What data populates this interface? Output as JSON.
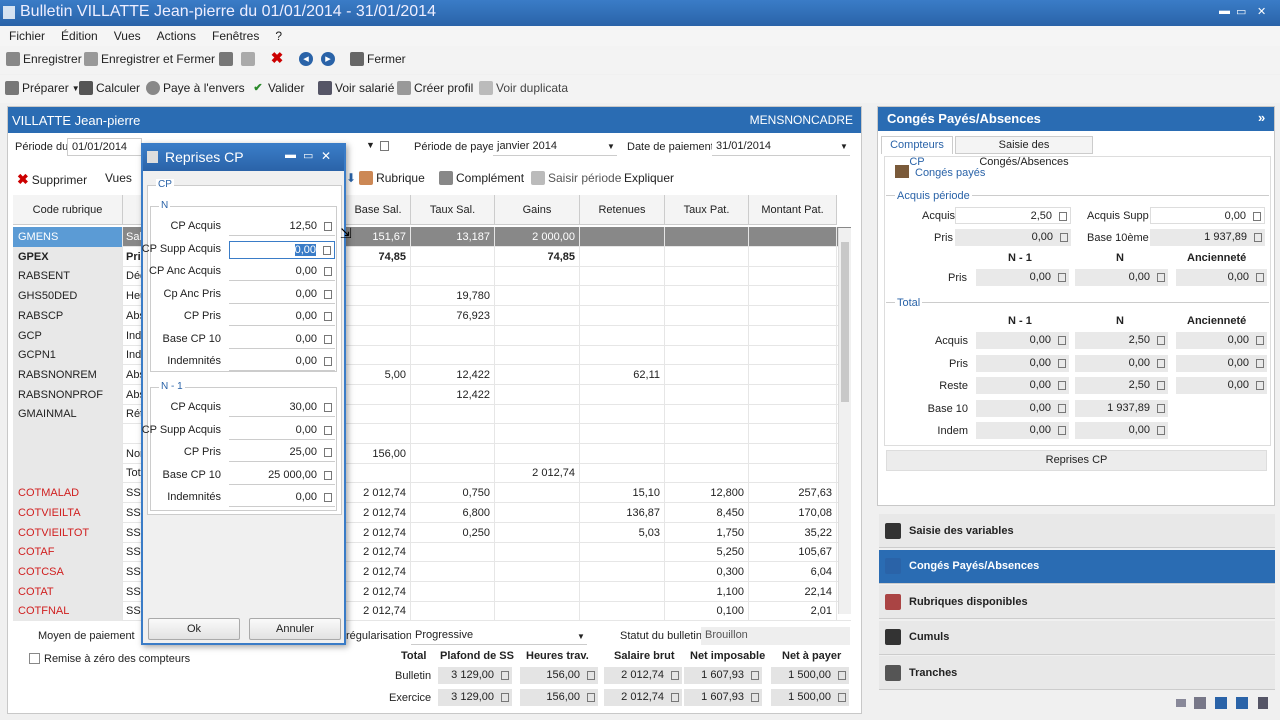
{
  "window": {
    "title": "Bulletin VILLATTE Jean-pierre du 01/01/2014 - 31/01/2014",
    "controls": [
      "▬",
      "▭",
      "✕"
    ]
  },
  "menu": [
    "Fichier",
    "Édition",
    "Vues",
    "Actions",
    "Fenêtres",
    "?"
  ],
  "toolbar1": {
    "save": "Enregistrer",
    "save_close": "Enregistrer et Fermer",
    "close": "Fermer"
  },
  "toolbar2": {
    "prepare": "Préparer",
    "compute": "Calculer",
    "reverse": "Paye à l'envers",
    "validate": "Valider",
    "view_employee": "Voir salarié",
    "create_profile": "Créer profil",
    "view_duplicate": "Voir duplicata"
  },
  "employee": {
    "name": "VILLATTE Jean-pierre",
    "category": "MENSNONCADRE"
  },
  "period": {
    "from_label": "Période du",
    "from": "01/01/2014",
    "pay_period_label": "Période de paye",
    "pay_period": "janvier 2014",
    "pay_date_label": "Date de paiement",
    "pay_date": "31/01/2014"
  },
  "actions": {
    "delete": "Supprimer",
    "views": "Vues",
    "rubric": "Rubrique",
    "complement": "Complément",
    "enter_period": "Saisir période",
    "explain": "Expliquer"
  },
  "grid": {
    "headers": [
      "Code rubrique",
      "Base Sal.",
      "Taux Sal.",
      "Gains",
      "Retenues",
      "Taux Pat.",
      "Montant Pat."
    ],
    "rows": [
      {
        "code": "GMENS",
        "lib": "Sal",
        "base": "151,67",
        "taux": "13,187",
        "gains": "2 000,00",
        "ret": "",
        "tpat": "",
        "mpat": "",
        "style": "sel"
      },
      {
        "code": "GPEX",
        "lib": "Pri",
        "base": "74,85",
        "taux": "",
        "gains": "74,85",
        "ret": "",
        "tpat": "",
        "mpat": "",
        "style": "bold"
      },
      {
        "code": "RABSENT",
        "lib": "Déd",
        "base": "",
        "taux": "",
        "gains": "",
        "ret": "",
        "tpat": "",
        "mpat": "",
        "style": ""
      },
      {
        "code": "GHS50DED",
        "lib": "Heu",
        "base": "",
        "taux": "19,780",
        "gains": "",
        "ret": "",
        "tpat": "",
        "mpat": "",
        "style": ""
      },
      {
        "code": "RABSCP",
        "lib": "Abs",
        "base": "",
        "taux": "76,923",
        "gains": "",
        "ret": "",
        "tpat": "",
        "mpat": "",
        "style": ""
      },
      {
        "code": "GCP",
        "lib": "Ind",
        "base": "",
        "taux": "",
        "gains": "",
        "ret": "",
        "tpat": "",
        "mpat": "",
        "style": ""
      },
      {
        "code": "GCPN1",
        "lib": "Ind",
        "base": "",
        "taux": "",
        "gains": "",
        "ret": "",
        "tpat": "",
        "mpat": "",
        "style": ""
      },
      {
        "code": "RABSNONREM",
        "lib": "Abs",
        "base": "5,00",
        "taux": "12,422",
        "gains": "",
        "ret": "62,11",
        "tpat": "",
        "mpat": "",
        "style": ""
      },
      {
        "code": "RABSNONPROF",
        "lib": "Abs",
        "base": "",
        "taux": "12,422",
        "gains": "",
        "ret": "",
        "tpat": "",
        "mpat": "",
        "style": ""
      },
      {
        "code": "GMAINMAL",
        "lib": "Rét",
        "base": "",
        "taux": "",
        "gains": "",
        "ret": "",
        "tpat": "",
        "mpat": "",
        "style": ""
      },
      {
        "code": "",
        "lib": "",
        "base": "",
        "taux": "",
        "gains": "",
        "ret": "",
        "tpat": "",
        "mpat": "",
        "style": ""
      },
      {
        "code": "",
        "lib": "Nor",
        "base": "156,00",
        "taux": "",
        "gains": "",
        "ret": "",
        "tpat": "",
        "mpat": "",
        "style": ""
      },
      {
        "code": "",
        "lib": "Tot",
        "base": "",
        "taux": "",
        "gains": "2 012,74",
        "ret": "",
        "tpat": "",
        "mpat": "",
        "style": ""
      },
      {
        "code": "COTMALAD",
        "lib": "SS",
        "base": "2 012,74",
        "taux": "0,750",
        "gains": "",
        "ret": "15,10",
        "tpat": "12,800",
        "mpat": "257,63",
        "style": "red"
      },
      {
        "code": "COTVIEILTA",
        "lib": "SS",
        "base": "2 012,74",
        "taux": "6,800",
        "gains": "",
        "ret": "136,87",
        "tpat": "8,450",
        "mpat": "170,08",
        "style": "red"
      },
      {
        "code": "COTVIEILTOT",
        "lib": "SS",
        "base": "2 012,74",
        "taux": "0,250",
        "gains": "",
        "ret": "5,03",
        "tpat": "1,750",
        "mpat": "35,22",
        "style": "red"
      },
      {
        "code": "COTAF",
        "lib": "SS",
        "base": "2 012,74",
        "taux": "",
        "gains": "",
        "ret": "",
        "tpat": "5,250",
        "mpat": "105,67",
        "style": "red"
      },
      {
        "code": "COTCSA",
        "lib": "SS",
        "base": "2 012,74",
        "taux": "",
        "gains": "",
        "ret": "",
        "tpat": "0,300",
        "mpat": "6,04",
        "style": "red"
      },
      {
        "code": "COTAT",
        "lib": "SS",
        "base": "2 012,74",
        "taux": "",
        "gains": "",
        "ret": "",
        "tpat": "1,100",
        "mpat": "22,14",
        "style": "red"
      },
      {
        "code": "COTFNAL",
        "lib": "SS",
        "base": "2 012,74",
        "taux": "",
        "gains": "",
        "ret": "",
        "tpat": "0,100",
        "mpat": "2,01",
        "style": "red"
      }
    ]
  },
  "footer": {
    "payment_label": "Moyen de paiement",
    "reset_label": "Remise à zéro des compteurs",
    "regul_label": "régularisation",
    "regul": "Progressive",
    "status_label": "Statut du bulletin",
    "status": "Brouillon",
    "headers": [
      "Total",
      "Plafond de SS",
      "Heures trav.",
      "Salaire brut",
      "Net imposable",
      "Net à payer"
    ],
    "rows": [
      {
        "label": "Bulletin",
        "vals": [
          "3 129,00",
          "156,00",
          "2 012,74",
          "1 607,93",
          "1 500,00"
        ]
      },
      {
        "label": "Exercice",
        "vals": [
          "3 129,00",
          "156,00",
          "2 012,74",
          "1 607,93",
          "1 500,00"
        ]
      }
    ]
  },
  "dialog": {
    "title": "Reprises CP",
    "group_cp": "CP",
    "group_n": "N",
    "group_n1": "N - 1",
    "n_fields": [
      {
        "label": "CP Acquis",
        "value": "12,50"
      },
      {
        "label": "CP Supp Acquis",
        "value": "0,00"
      },
      {
        "label": "CP Anc Acquis",
        "value": "0,00"
      },
      {
        "label": "Cp Anc Pris",
        "value": "0,00"
      },
      {
        "label": "CP Pris",
        "value": "0,00"
      },
      {
        "label": "Base CP 10",
        "value": "0,00"
      },
      {
        "label": "Indemnités",
        "value": "0,00"
      }
    ],
    "n1_fields": [
      {
        "label": "CP Acquis",
        "value": "30,00"
      },
      {
        "label": "CP Supp Acquis",
        "value": "0,00"
      },
      {
        "label": "CP Pris",
        "value": "25,00"
      },
      {
        "label": "Base CP 10",
        "value": "25 000,00"
      },
      {
        "label": "Indemnités",
        "value": "0,00"
      }
    ],
    "ok": "Ok",
    "cancel": "Annuler"
  },
  "right": {
    "title": "Congés Payés/Absences",
    "tabs": [
      "Compteurs CP",
      "Saisie des Congés/Absences"
    ],
    "section": "Congés payés",
    "acquis_periode": "Acquis période",
    "acquis_label": "Acquis",
    "acquis": "2,50",
    "acquis_supp_label": "Acquis Supp",
    "acquis_supp": "0,00",
    "pris_label": "Pris",
    "pris": "0,00",
    "base10_label": "Base 10ème",
    "base10": "1 937,89",
    "cols": [
      "N - 1",
      "N",
      "Ancienneté"
    ],
    "pris_row": [
      "0,00",
      "0,00",
      "0,00"
    ],
    "total": "Total",
    "total_rows": [
      {
        "label": "Acquis",
        "vals": [
          "0,00",
          "2,50",
          "0,00"
        ]
      },
      {
        "label": "Pris",
        "vals": [
          "0,00",
          "0,00",
          "0,00"
        ]
      },
      {
        "label": "Reste",
        "vals": [
          "0,00",
          "2,50",
          "0,00"
        ]
      },
      {
        "label": "Base 10",
        "vals": [
          "0,00",
          "1 937,89",
          ""
        ]
      },
      {
        "label": "Indem",
        "vals": [
          "0,00",
          "0,00",
          ""
        ]
      }
    ],
    "reprises_btn": "Reprises CP"
  },
  "nav": [
    {
      "label": "Saisie des variables",
      "sel": false
    },
    {
      "label": "Congés Payés/Absences",
      "sel": true
    },
    {
      "label": "Rubriques disponibles",
      "sel": false
    },
    {
      "label": "Cumuls",
      "sel": false
    },
    {
      "label": "Tranches",
      "sel": false
    }
  ]
}
